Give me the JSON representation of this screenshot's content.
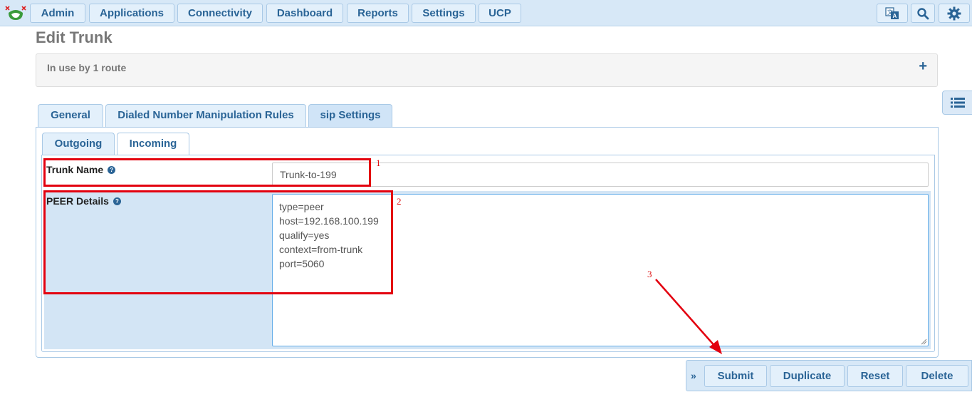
{
  "nav": {
    "items": [
      "Admin",
      "Applications",
      "Connectivity",
      "Dashboard",
      "Reports",
      "Settings",
      "UCP"
    ],
    "icons": [
      "translate-icon",
      "search-icon",
      "gear-icon"
    ]
  },
  "page": {
    "title": "Edit Trunk"
  },
  "usage": {
    "text": "In use by 1 route",
    "toggle": "+"
  },
  "tabs": [
    "General",
    "Dialed Number Manipulation Rules",
    "sip Settings"
  ],
  "active_tab": "sip Settings",
  "subtabs": [
    "Outgoing",
    "Incoming"
  ],
  "active_subtab": "Outgoing",
  "form": {
    "trunk_name_label": "Trunk Name",
    "trunk_name_value": "Trunk-to-199",
    "peer_details_label": "PEER Details",
    "peer_details_value": "type=peer\nhost=192.168.100.199\nqualify=yes\ncontext=from-trunk\nport=5060"
  },
  "actions": {
    "collapse": "»",
    "buttons": [
      "Submit",
      "Duplicate",
      "Reset",
      "Delete"
    ]
  },
  "annotations": {
    "labels": [
      "1",
      "2",
      "3"
    ],
    "color": "#e3000f"
  },
  "colors": {
    "nav_bg": "#d7e8f7",
    "link": "#2a6496",
    "peer_row_bg": "#d3e5f5"
  }
}
